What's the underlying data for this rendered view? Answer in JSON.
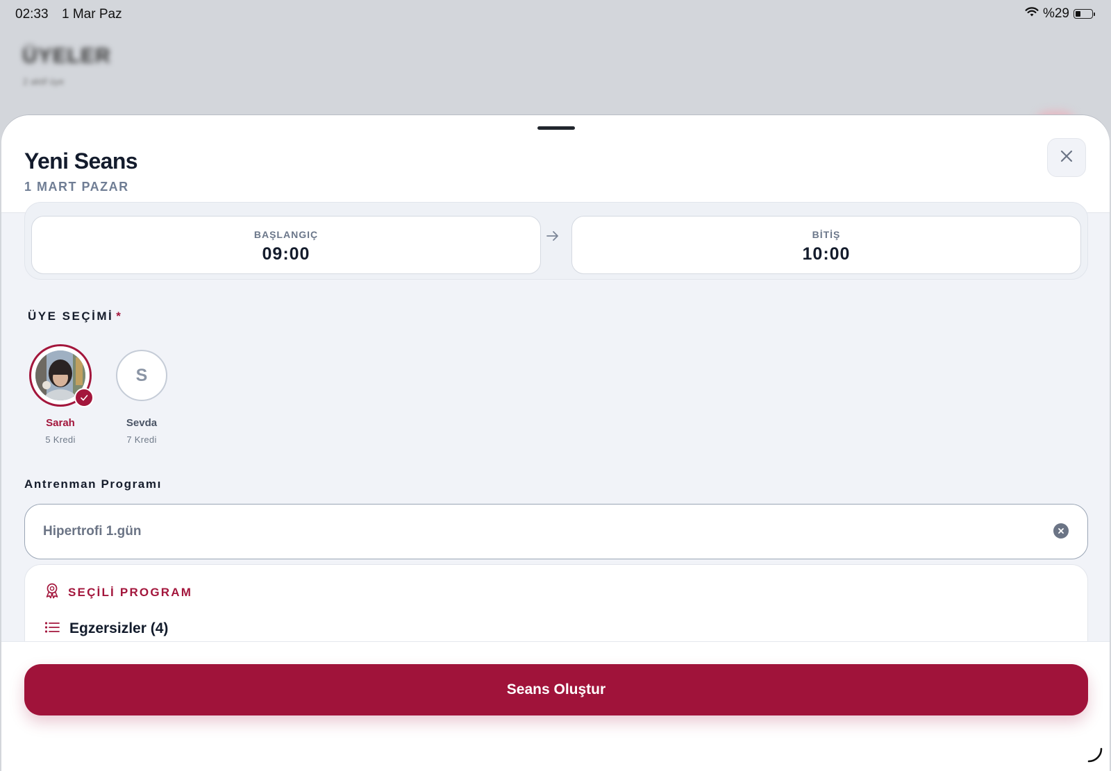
{
  "status_bar": {
    "time": "02:33",
    "date": "1 Mar Paz",
    "battery_text": "%29",
    "battery_level": 0.29,
    "icons": [
      "wifi-icon",
      "battery-icon"
    ]
  },
  "background": {
    "title": "ÜYELER",
    "subtitle": "2 aktif üye"
  },
  "sheet": {
    "title": "Yeni Seans",
    "date": "1 MART PAZAR",
    "close_icon": "close-icon"
  },
  "time": {
    "start_label": "BAŞLANGIÇ",
    "start_value": "09:00",
    "end_label": "BİTİŞ",
    "end_value": "10:00",
    "arrow_icon": "arrow-right-icon"
  },
  "members_section": {
    "label": "ÜYE SEÇİMİ",
    "required_mark": "*",
    "members": [
      {
        "name": "Sarah",
        "credit": "5 Kredi",
        "selected": true,
        "avatar": "photo"
      },
      {
        "name": "Sevda",
        "credit": "7 Kredi",
        "selected": false,
        "initial": "S"
      }
    ]
  },
  "program": {
    "label": "Antrenman Programı",
    "input_value": "Hipertrofi 1.gün",
    "clear_icon": "clear-circle-icon",
    "card_title": "SEÇİLİ PROGRAM",
    "card_icon": "award-icon",
    "exercises_label": "Egzersizler (4)",
    "exercises_icon": "list-icon"
  },
  "footer": {
    "create_button": "Seans Oluştur"
  },
  "colors": {
    "accent": "#a0133a",
    "text_dark": "#131b2c",
    "text_muted": "#6f7d94",
    "sheet_bg": "#f1f3f8"
  }
}
